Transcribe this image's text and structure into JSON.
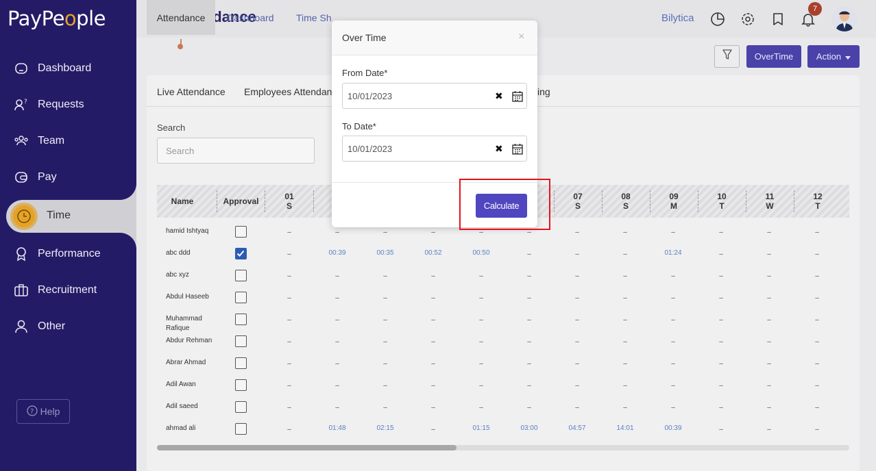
{
  "app": {
    "logo_prefix": "PayPe",
    "logo_o": "o",
    "logo_suffix": "ple"
  },
  "sidebar": {
    "items": [
      {
        "label": "Dashboard",
        "icon": "home-icon"
      },
      {
        "label": "Requests",
        "icon": "requests-icon"
      },
      {
        "label": "Team",
        "icon": "team-icon"
      },
      {
        "label": "Pay",
        "icon": "wallet-icon"
      },
      {
        "label": "Time",
        "icon": "clock-icon",
        "active": true
      },
      {
        "label": "Performance",
        "icon": "award-icon"
      },
      {
        "label": "Recruitment",
        "icon": "briefcase-icon"
      },
      {
        "label": "Other",
        "icon": "user-icon"
      }
    ],
    "help_label": "Help"
  },
  "header": {
    "title": "Attendance",
    "company": "Bilytica",
    "notification_count": "7"
  },
  "tabs": [
    "Attendance",
    "Dashboard",
    "Time Sh"
  ],
  "toolbar": {
    "overtime_label": "OverTime",
    "action_label": "Action"
  },
  "subtabs": [
    "Live Attendance",
    "Employees Attendan",
    "ing"
  ],
  "search": {
    "label": "Search",
    "placeholder": "Search"
  },
  "table": {
    "headers": {
      "name": "Name",
      "approval": "Approval"
    },
    "days": [
      {
        "d": "01",
        "w": "S"
      },
      {
        "d": "07",
        "w": "S"
      },
      {
        "d": "08",
        "w": "S"
      },
      {
        "d": "09",
        "w": "M"
      },
      {
        "d": "10",
        "w": "T"
      },
      {
        "d": "11",
        "w": "W"
      },
      {
        "d": "12",
        "w": "T"
      }
    ],
    "rows": [
      {
        "name": "hamid Ishtyaq",
        "checked": false,
        "cells": [
          "–",
          "–",
          "–",
          "–",
          "–",
          "–",
          "–",
          "–",
          "–",
          "–",
          "–",
          "–"
        ]
      },
      {
        "name": "abc ddd",
        "checked": true,
        "cells": [
          "–",
          "00:39",
          "00:35",
          "00:52",
          "00:50",
          "–",
          "–",
          "–",
          "01:24",
          "–",
          "–",
          "–"
        ]
      },
      {
        "name": "abc xyz",
        "checked": false,
        "cells": [
          "–",
          "–",
          "–",
          "–",
          "–",
          "–",
          "–",
          "–",
          "–",
          "–",
          "–",
          "–"
        ]
      },
      {
        "name": "Abdul Haseeb",
        "checked": false,
        "cells": [
          "–",
          "–",
          "–",
          "–",
          "–",
          "–",
          "–",
          "–",
          "–",
          "–",
          "–",
          "–"
        ]
      },
      {
        "name": "Muhammad Rafique",
        "checked": false,
        "cells": [
          "–",
          "–",
          "–",
          "–",
          "–",
          "–",
          "–",
          "–",
          "–",
          "–",
          "–",
          "–"
        ]
      },
      {
        "name": "Abdur Rehman",
        "checked": false,
        "cells": [
          "–",
          "–",
          "–",
          "–",
          "–",
          "–",
          "–",
          "–",
          "–",
          "–",
          "–",
          "–"
        ]
      },
      {
        "name": "Abrar Ahmad",
        "checked": false,
        "cells": [
          "–",
          "–",
          "–",
          "–",
          "–",
          "–",
          "–",
          "–",
          "–",
          "–",
          "–",
          "–"
        ]
      },
      {
        "name": "Adil Awan",
        "checked": false,
        "cells": [
          "–",
          "–",
          "–",
          "–",
          "–",
          "–",
          "–",
          "–",
          "–",
          "–",
          "–",
          "–"
        ]
      },
      {
        "name": "Adil saeed",
        "checked": false,
        "cells": [
          "–",
          "–",
          "–",
          "–",
          "–",
          "–",
          "–",
          "–",
          "–",
          "–",
          "–",
          "–"
        ]
      },
      {
        "name": "ahmad ali",
        "checked": false,
        "cells": [
          "–",
          "01:48",
          "02:15",
          "–",
          "01:15",
          "03:00",
          "04:57",
          "14:01",
          "00:39",
          "–",
          "–",
          "–"
        ]
      }
    ]
  },
  "modal": {
    "title": "Over Time",
    "close": "×",
    "from_label": "From Date*",
    "from_value": "10/01/2023",
    "to_label": "To Date*",
    "to_value": "10/01/2023",
    "calculate_label": "Calculate"
  },
  "colors": {
    "sidebar": "#241b66",
    "accent": "#4a42a8",
    "brand_orange": "#e6a226",
    "highlight": "#e3141b"
  }
}
